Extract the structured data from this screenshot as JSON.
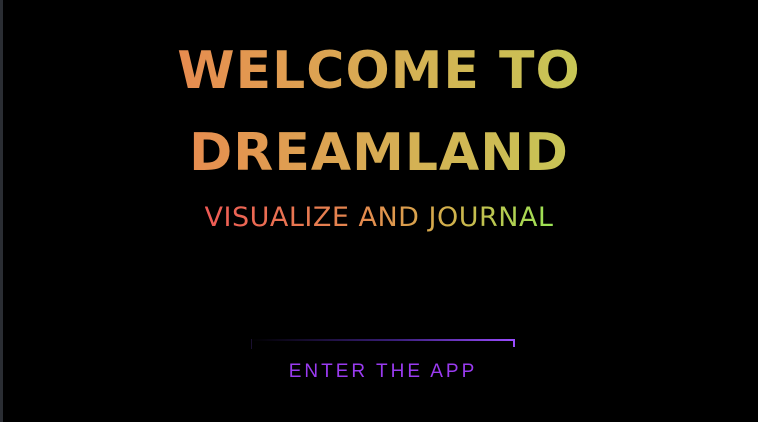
{
  "hero": {
    "title_line1": "WELCOME TO",
    "title_line2": "DREAMLAND",
    "subtitle": "VISUALIZE AND JOURNAL"
  },
  "cta": {
    "label": "ENTER THE APP"
  },
  "colors": {
    "background": "#000000",
    "title_gradient_start": "#f06a4c",
    "title_gradient_end": "#b8dc56",
    "subtitle_gradient_start": "#ef5a55",
    "subtitle_gradient_end": "#9be455",
    "button_accent": "#9a3bf0"
  }
}
